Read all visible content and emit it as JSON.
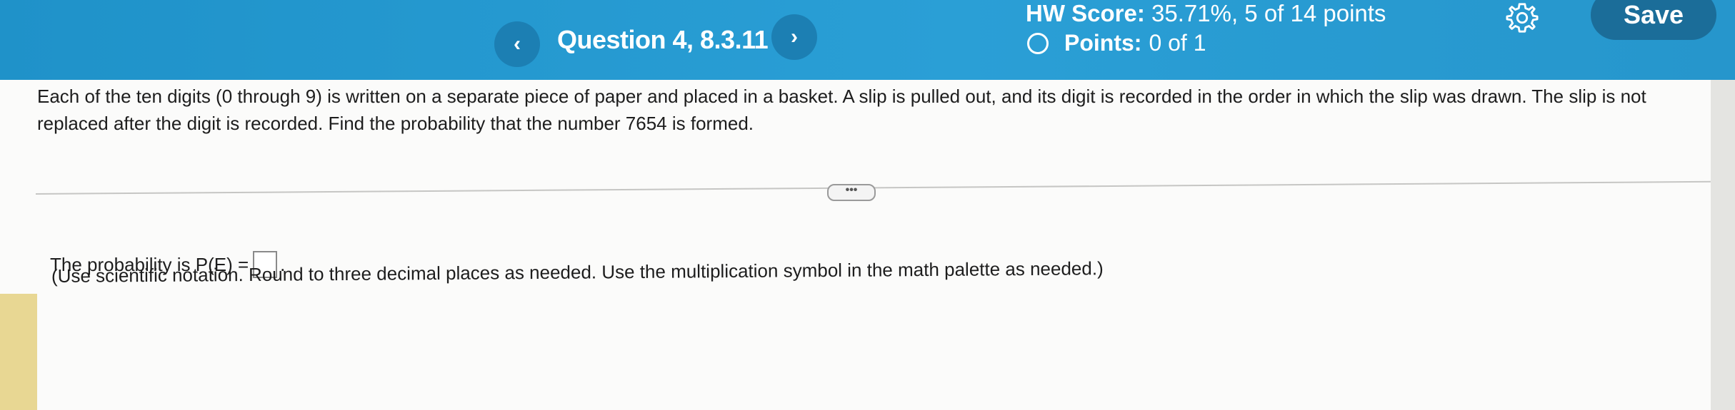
{
  "header": {
    "prev_glyph": "‹",
    "next_glyph": "›",
    "question_title": "Question 4, 8.3.11",
    "hw_score_label": "HW Score:",
    "hw_score_value": "35.71%, 5 of 14 points",
    "points_label": "Points:",
    "points_value": "0 of 1",
    "save_label": "Save",
    "settings_icon": "gear-icon"
  },
  "question": {
    "text": "Each of the ten digits (0 through 9) is written on a separate piece of paper and placed in a basket. A slip is pulled out, and its digit is recorded in the order in which the slip was drawn. The slip is not replaced after the digit is recorded. Find the probability that the number 7654 is formed."
  },
  "divider": {
    "more_label": "•••"
  },
  "answer": {
    "prefix": "The probability is P(E) =",
    "input_value": "",
    "suffix": ".",
    "hint": "(Use scientific notation. Round to three decimal places as needed. Use the multiplication symbol in the math palette as needed.)"
  },
  "colors": {
    "header_blue": "#2a9fd6",
    "save_button": "#1b6d99"
  }
}
